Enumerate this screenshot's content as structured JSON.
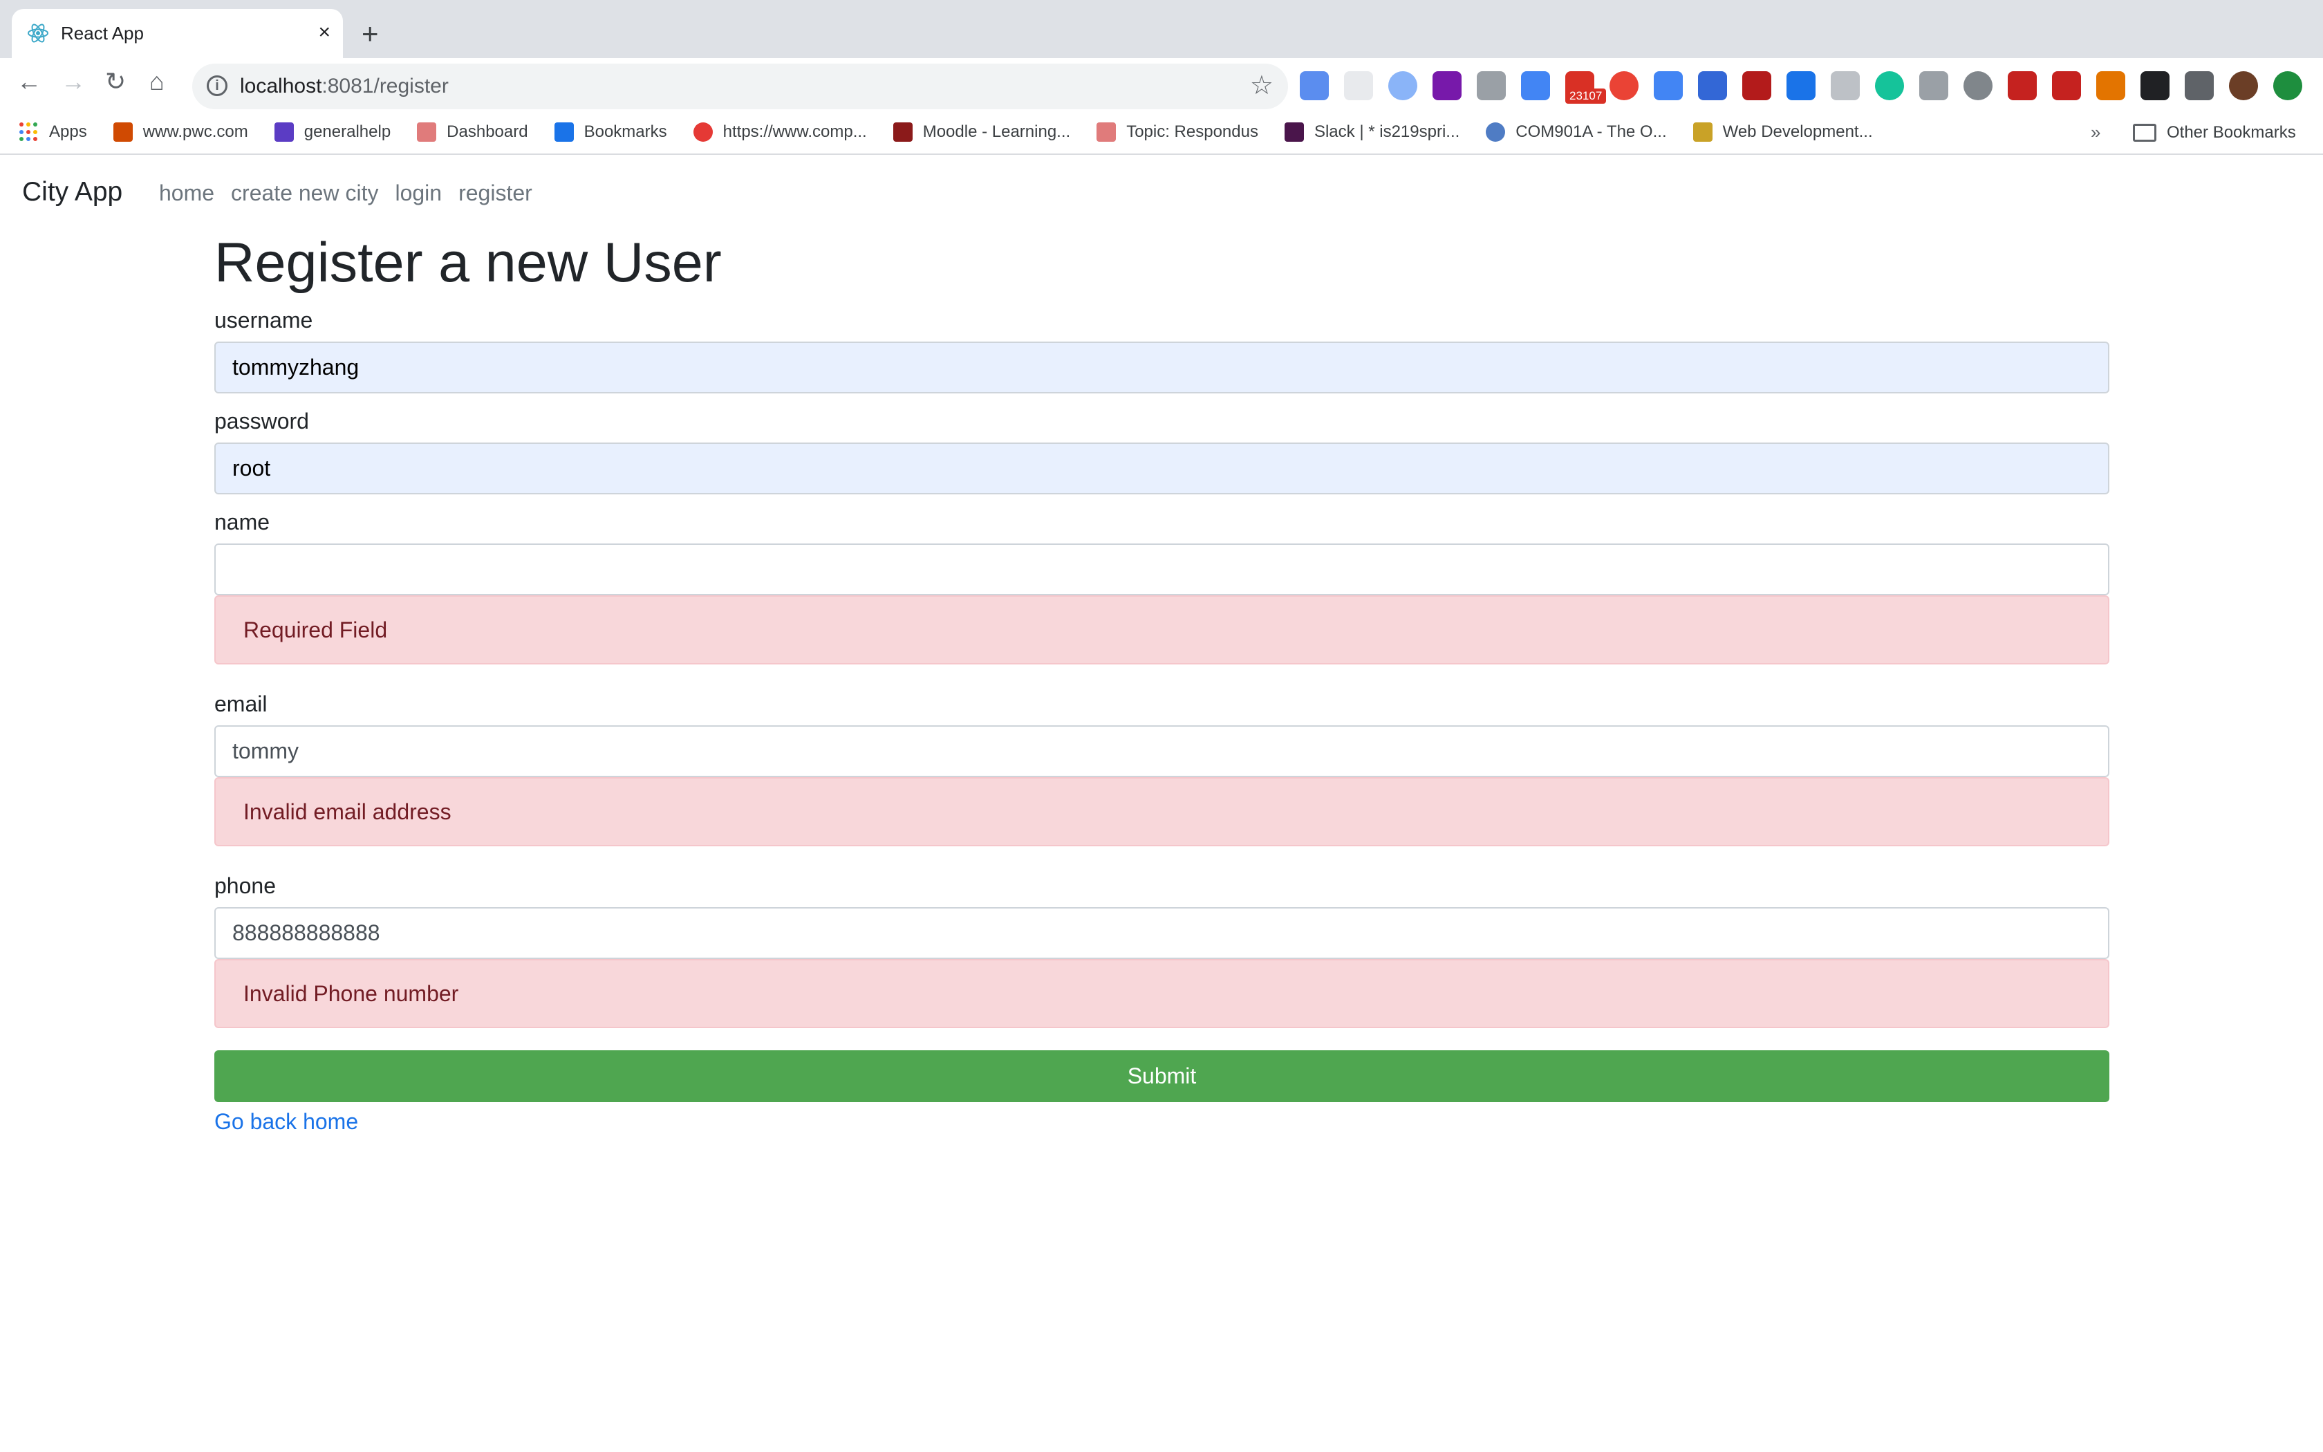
{
  "browser": {
    "tab_title": "React App",
    "close_glyph": "×",
    "new_tab_glyph": "+",
    "url_host": "localhost",
    "url_path": ":8081/register",
    "info_glyph": "i",
    "star_glyph": "☆",
    "back_glyph": "←",
    "forward_glyph": "→",
    "reload_glyph": "↻",
    "home_glyph": "⌂",
    "ext_badge": "23107",
    "bookmarks": [
      {
        "label": "Apps",
        "color": "#4285f4"
      },
      {
        "label": "www.pwc.com",
        "color": "#d04a02"
      },
      {
        "label": "generalhelp",
        "color": "#5b3cc4"
      },
      {
        "label": "Dashboard",
        "color": "#e07b7b"
      },
      {
        "label": "Bookmarks",
        "color": "#1a73e8"
      },
      {
        "label": "https://www.comp...",
        "color": "#e53935"
      },
      {
        "label": "Moodle - Learning...",
        "color": "#8b1a1a"
      },
      {
        "label": "Topic: Respondus",
        "color": "#e07b7b"
      },
      {
        "label": "Slack | * is219spri...",
        "color": "#4a154b"
      },
      {
        "label": "COM901A - The O...",
        "color": "#4f7cc4"
      },
      {
        "label": "Web Development...",
        "color": "#c9a227"
      }
    ],
    "more_glyph": "»",
    "other_bookmarks": "Other Bookmarks"
  },
  "app": {
    "brand": "City App",
    "nav": [
      "home",
      "create new city",
      "login",
      "register"
    ],
    "heading": "Register a new User",
    "fields": {
      "username": {
        "label": "username",
        "value": "tommyzhang"
      },
      "password": {
        "label": "password",
        "value": "root"
      },
      "name": {
        "label": "name",
        "value": "",
        "error": "Required Field"
      },
      "email": {
        "label": "email",
        "value": "tommy",
        "error": "Invalid email address"
      },
      "phone": {
        "label": "phone",
        "value": "888888888888",
        "error": "Invalid Phone number"
      }
    },
    "submit_label": "Submit",
    "back_link": "Go back home"
  }
}
